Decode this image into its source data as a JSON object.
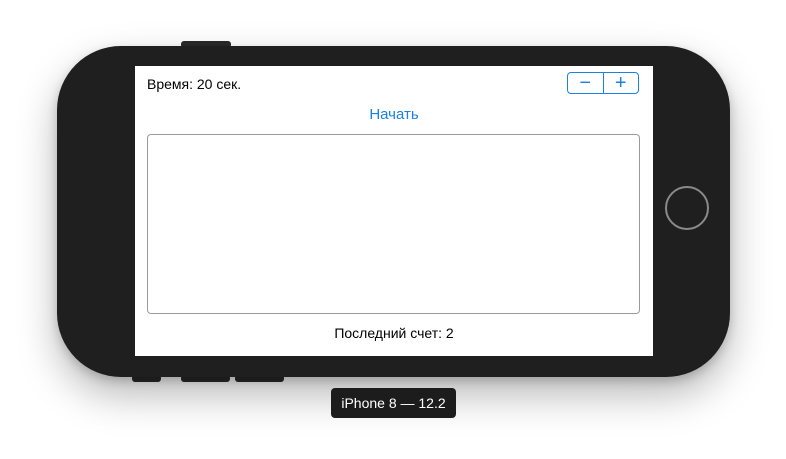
{
  "screen": {
    "time_label": "Время: 20 сек.",
    "stepper": {
      "decrement": "−",
      "increment": "+"
    },
    "start_button": "Начать",
    "text_area_value": "",
    "last_score": "Последний счет: 2"
  },
  "device_label": "iPhone 8 — 12.2",
  "colors": {
    "accent": "#1a82e2",
    "device_body": "#1f1f1f"
  }
}
